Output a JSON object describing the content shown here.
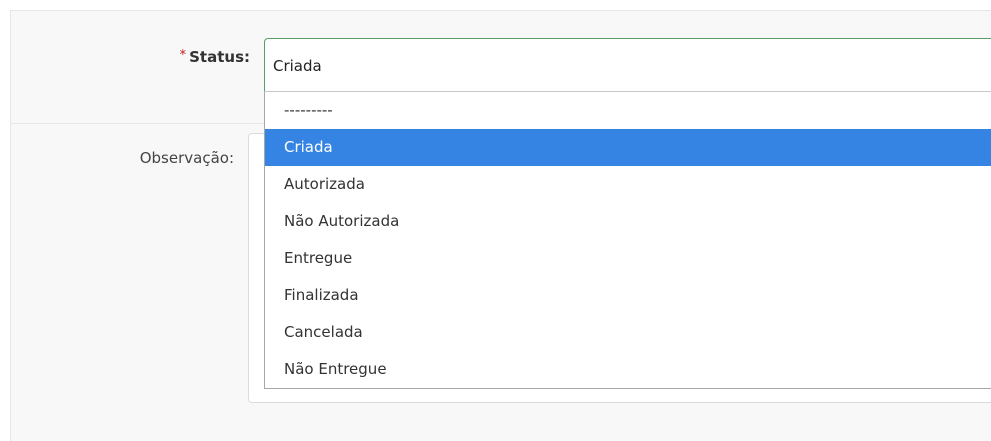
{
  "form": {
    "status_label": "Status:",
    "required_mark": "*",
    "status_value": "Criada",
    "observacao_label": "Observação:"
  },
  "dropdown": {
    "selected_index": 1,
    "options": [
      "---------",
      "Criada",
      "Autorizada",
      "Não Autorizada",
      "Entregue",
      "Finalizada",
      "Cancelada",
      "Não Entregue"
    ]
  },
  "colors": {
    "highlight": "#3584e4",
    "focus_border": "#5a9e66",
    "required": "#ba2121"
  }
}
